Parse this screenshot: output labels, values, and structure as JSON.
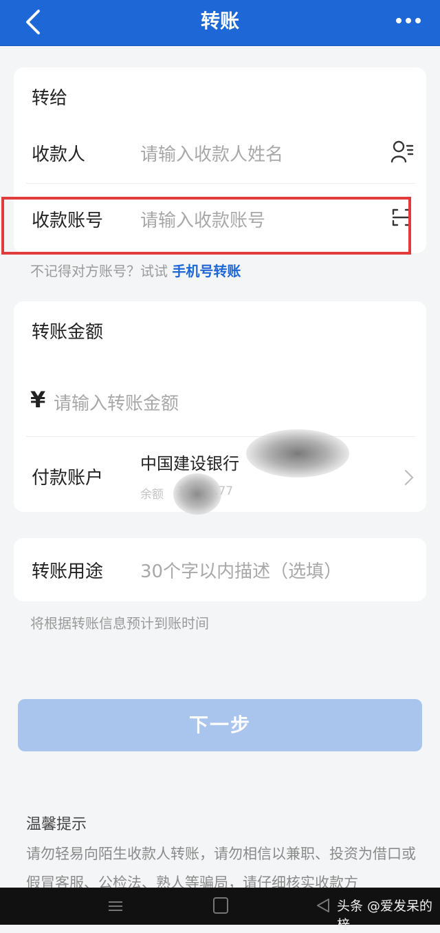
{
  "header": {
    "title": "转账",
    "back_icon": "chevron-left-icon",
    "more_icon": "more-dots-icon"
  },
  "recipient": {
    "section_title": "转给",
    "name_label": "收款人",
    "name_placeholder": "请输入收款人姓名",
    "contact_icon": "contacts-icon",
    "account_label": "收款账号",
    "account_placeholder": "请输入收款账号",
    "scan_icon": "scan-icon",
    "hint_text": "不记得对方账号？试试 ",
    "hint_link": "手机号转账"
  },
  "amount": {
    "section_title": "转账金额",
    "currency_symbol": "¥",
    "amount_placeholder": "请输入转账金额",
    "payer_label": "付款账户",
    "bank_name": "中国建设银行",
    "balance_label": "余额",
    "balance_value": "10351.77"
  },
  "purpose": {
    "label": "转账用途",
    "placeholder": "30个字以内描述（选填）",
    "note": "将根据转账信息预计到账时间"
  },
  "next_button": "下一步",
  "tips": {
    "title": "温馨提示",
    "text": "请勿轻易向陌生收款人转账，请勿相信以兼职、投资为借口或假冒客服、公检法、熟人等骗局，请仔细核实收款方"
  },
  "watermark": "头条 @爱发呆的梓",
  "colors": {
    "brand_blue": "#1e67d6",
    "highlight_red": "#e23b3b",
    "button_disabled": "#a9c4ed"
  }
}
